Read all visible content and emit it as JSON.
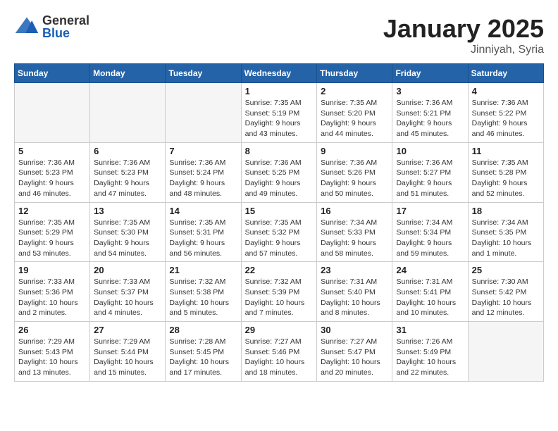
{
  "header": {
    "logo_general": "General",
    "logo_blue": "Blue",
    "month": "January 2025",
    "location": "Jinniyah, Syria"
  },
  "days_of_week": [
    "Sunday",
    "Monday",
    "Tuesday",
    "Wednesday",
    "Thursday",
    "Friday",
    "Saturday"
  ],
  "weeks": [
    [
      {
        "day": "",
        "info": ""
      },
      {
        "day": "",
        "info": ""
      },
      {
        "day": "",
        "info": ""
      },
      {
        "day": "1",
        "info": "Sunrise: 7:35 AM\nSunset: 5:19 PM\nDaylight: 9 hours and 43 minutes."
      },
      {
        "day": "2",
        "info": "Sunrise: 7:35 AM\nSunset: 5:20 PM\nDaylight: 9 hours and 44 minutes."
      },
      {
        "day": "3",
        "info": "Sunrise: 7:36 AM\nSunset: 5:21 PM\nDaylight: 9 hours and 45 minutes."
      },
      {
        "day": "4",
        "info": "Sunrise: 7:36 AM\nSunset: 5:22 PM\nDaylight: 9 hours and 46 minutes."
      }
    ],
    [
      {
        "day": "5",
        "info": "Sunrise: 7:36 AM\nSunset: 5:23 PM\nDaylight: 9 hours and 46 minutes."
      },
      {
        "day": "6",
        "info": "Sunrise: 7:36 AM\nSunset: 5:23 PM\nDaylight: 9 hours and 47 minutes."
      },
      {
        "day": "7",
        "info": "Sunrise: 7:36 AM\nSunset: 5:24 PM\nDaylight: 9 hours and 48 minutes."
      },
      {
        "day": "8",
        "info": "Sunrise: 7:36 AM\nSunset: 5:25 PM\nDaylight: 9 hours and 49 minutes."
      },
      {
        "day": "9",
        "info": "Sunrise: 7:36 AM\nSunset: 5:26 PM\nDaylight: 9 hours and 50 minutes."
      },
      {
        "day": "10",
        "info": "Sunrise: 7:36 AM\nSunset: 5:27 PM\nDaylight: 9 hours and 51 minutes."
      },
      {
        "day": "11",
        "info": "Sunrise: 7:35 AM\nSunset: 5:28 PM\nDaylight: 9 hours and 52 minutes."
      }
    ],
    [
      {
        "day": "12",
        "info": "Sunrise: 7:35 AM\nSunset: 5:29 PM\nDaylight: 9 hours and 53 minutes."
      },
      {
        "day": "13",
        "info": "Sunrise: 7:35 AM\nSunset: 5:30 PM\nDaylight: 9 hours and 54 minutes."
      },
      {
        "day": "14",
        "info": "Sunrise: 7:35 AM\nSunset: 5:31 PM\nDaylight: 9 hours and 56 minutes."
      },
      {
        "day": "15",
        "info": "Sunrise: 7:35 AM\nSunset: 5:32 PM\nDaylight: 9 hours and 57 minutes."
      },
      {
        "day": "16",
        "info": "Sunrise: 7:34 AM\nSunset: 5:33 PM\nDaylight: 9 hours and 58 minutes."
      },
      {
        "day": "17",
        "info": "Sunrise: 7:34 AM\nSunset: 5:34 PM\nDaylight: 9 hours and 59 minutes."
      },
      {
        "day": "18",
        "info": "Sunrise: 7:34 AM\nSunset: 5:35 PM\nDaylight: 10 hours and 1 minute."
      }
    ],
    [
      {
        "day": "19",
        "info": "Sunrise: 7:33 AM\nSunset: 5:36 PM\nDaylight: 10 hours and 2 minutes."
      },
      {
        "day": "20",
        "info": "Sunrise: 7:33 AM\nSunset: 5:37 PM\nDaylight: 10 hours and 4 minutes."
      },
      {
        "day": "21",
        "info": "Sunrise: 7:32 AM\nSunset: 5:38 PM\nDaylight: 10 hours and 5 minutes."
      },
      {
        "day": "22",
        "info": "Sunrise: 7:32 AM\nSunset: 5:39 PM\nDaylight: 10 hours and 7 minutes."
      },
      {
        "day": "23",
        "info": "Sunrise: 7:31 AM\nSunset: 5:40 PM\nDaylight: 10 hours and 8 minutes."
      },
      {
        "day": "24",
        "info": "Sunrise: 7:31 AM\nSunset: 5:41 PM\nDaylight: 10 hours and 10 minutes."
      },
      {
        "day": "25",
        "info": "Sunrise: 7:30 AM\nSunset: 5:42 PM\nDaylight: 10 hours and 12 minutes."
      }
    ],
    [
      {
        "day": "26",
        "info": "Sunrise: 7:29 AM\nSunset: 5:43 PM\nDaylight: 10 hours and 13 minutes."
      },
      {
        "day": "27",
        "info": "Sunrise: 7:29 AM\nSunset: 5:44 PM\nDaylight: 10 hours and 15 minutes."
      },
      {
        "day": "28",
        "info": "Sunrise: 7:28 AM\nSunset: 5:45 PM\nDaylight: 10 hours and 17 minutes."
      },
      {
        "day": "29",
        "info": "Sunrise: 7:27 AM\nSunset: 5:46 PM\nDaylight: 10 hours and 18 minutes."
      },
      {
        "day": "30",
        "info": "Sunrise: 7:27 AM\nSunset: 5:47 PM\nDaylight: 10 hours and 20 minutes."
      },
      {
        "day": "31",
        "info": "Sunrise: 7:26 AM\nSunset: 5:49 PM\nDaylight: 10 hours and 22 minutes."
      },
      {
        "day": "",
        "info": ""
      }
    ]
  ]
}
